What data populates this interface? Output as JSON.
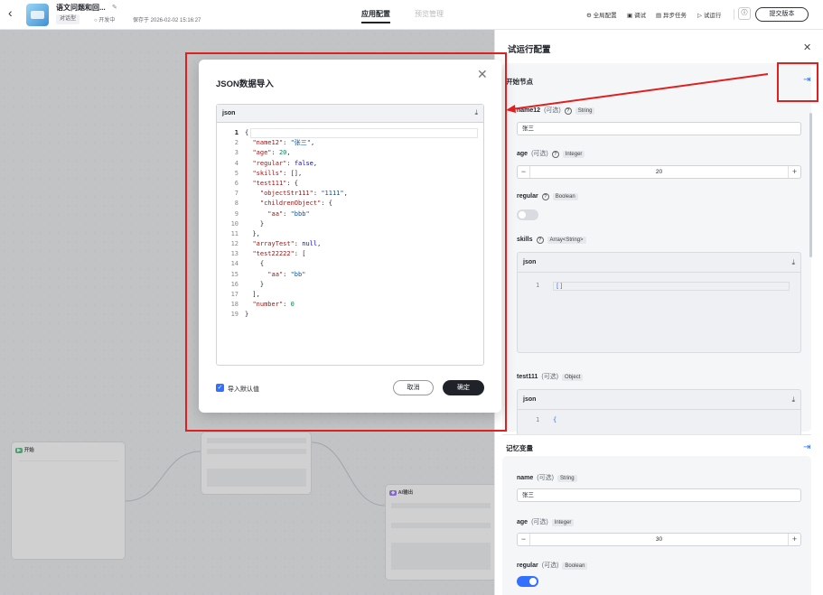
{
  "header": {
    "app_title": "语文问题和回...",
    "type_tag": "对话型",
    "status": "开发中",
    "saved": "保存于 2026-02-02 15:16:27",
    "tabs": [
      "应用配置",
      "预览管理"
    ],
    "tools": [
      "全局配置",
      "调试",
      "异步任务",
      "试运行"
    ],
    "submit": "提交版本"
  },
  "modal": {
    "title": "JSON数据导入",
    "editor_tab": "json",
    "lines": [
      {
        "n": "1",
        "t": "{"
      },
      {
        "n": "2",
        "t": "  \"name12\": \"张三\","
      },
      {
        "n": "3",
        "t": "  \"age\": 20,"
      },
      {
        "n": "4",
        "t": "  \"regular\": false,"
      },
      {
        "n": "5",
        "t": "  \"skills\": [],"
      },
      {
        "n": "6",
        "t": "  \"test111\": {"
      },
      {
        "n": "7",
        "t": "    \"objectStr111\": \"1111\","
      },
      {
        "n": "8",
        "t": "    \"childrenObject\": {"
      },
      {
        "n": "9",
        "t": "      \"aa\": \"bbb\""
      },
      {
        "n": "10",
        "t": "    }"
      },
      {
        "n": "11",
        "t": "  },"
      },
      {
        "n": "12",
        "t": "  \"arrayTest\": null,"
      },
      {
        "n": "13",
        "t": "  \"test22222\": ["
      },
      {
        "n": "14",
        "t": "    {"
      },
      {
        "n": "15",
        "t": "      \"aa\": \"bb\""
      },
      {
        "n": "16",
        "t": "    }"
      },
      {
        "n": "17",
        "t": "  ],"
      },
      {
        "n": "18",
        "t": "  \"number\": 0"
      },
      {
        "n": "19",
        "t": "}"
      }
    ],
    "checkbox_label": "导入默认值",
    "cancel": "取消",
    "confirm": "确定"
  },
  "panel": {
    "title": "试运行配置",
    "section_start": "开始节点",
    "section_memory": "记忆变量",
    "optional": "(可选)",
    "fields": {
      "name12": {
        "label": "name12",
        "type": "String",
        "value": "张三"
      },
      "age": {
        "label": "age",
        "type": "Integer",
        "value": "20"
      },
      "regular": {
        "label": "regular",
        "type": "Boolean"
      },
      "skills": {
        "label": "skills",
        "type": "Array<String>",
        "json_tab": "json",
        "line_no": "1",
        "line": "[]"
      },
      "test111": {
        "label": "test111",
        "type": "Object",
        "json_tab": "json",
        "line_no": "1",
        "line": "{"
      }
    },
    "memory": {
      "name": {
        "label": "name",
        "type": "String",
        "value": "张三"
      },
      "age": {
        "label": "age",
        "type": "Integer",
        "value": "30"
      },
      "regular": {
        "label": "regular",
        "type": "Boolean"
      }
    }
  },
  "canvas": {
    "start_node": "开始",
    "ai_node": "AI输出"
  },
  "colors": {
    "accent": "#3370ff",
    "annotation": "#e02020"
  }
}
